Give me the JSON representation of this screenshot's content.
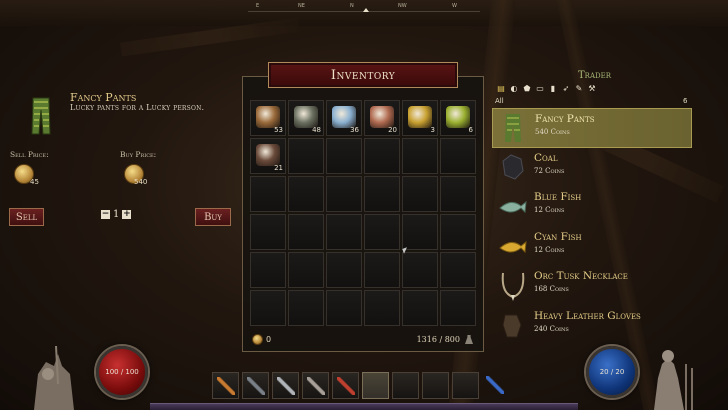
{
  "compass": {
    "ticks": [
      "E",
      "",
      "NE",
      "",
      "N",
      "",
      "NW",
      "",
      "W"
    ]
  },
  "selected_item": {
    "name": "Fancy Pants",
    "description": "Lucky pants for a Lucky person.",
    "sell_label": "Sell Price:",
    "sell_price": "45",
    "buy_label": "Buy Price:",
    "buy_price": "540",
    "sell_button": "Sell",
    "buy_button": "Buy",
    "quantity": "1",
    "minus": "−",
    "plus": "+"
  },
  "inventory": {
    "title": "Inventory",
    "items": [
      {
        "icon": "log-icon",
        "count": "53",
        "color": "#9a6a3a"
      },
      {
        "icon": "ore-icon",
        "count": "48",
        "color": "#6a7060"
      },
      {
        "icon": "fish-icon",
        "count": "36",
        "color": "#8ab0d0"
      },
      {
        "icon": "copper-ore-icon",
        "count": "20",
        "color": "#b06a50"
      },
      {
        "icon": "herb-icon",
        "count": "3",
        "color": "#c8a030"
      },
      {
        "icon": "flower-icon",
        "count": "6",
        "color": "#9ab030"
      },
      {
        "icon": "coal-icon",
        "count": "21",
        "color": "#6a4a3a"
      }
    ],
    "gold": "0",
    "weight": "1316 / 800"
  },
  "trader": {
    "title": "Trader",
    "filter_all": "All",
    "count": "6",
    "filters": [
      "▤",
      "◐",
      "⬟",
      "▭",
      "▮",
      "➶",
      "✎",
      "⚒"
    ],
    "items": [
      {
        "name": "Fancy Pants",
        "price": "540 Coins",
        "icon": "pants-icon",
        "selected": true
      },
      {
        "name": "Coal",
        "price": "72 Coins",
        "icon": "coal-icon",
        "selected": false
      },
      {
        "name": "Blue Fish",
        "price": "12 Coins",
        "icon": "blue-fish-icon",
        "selected": false
      },
      {
        "name": "Cyan Fish",
        "price": "12 Coins",
        "icon": "cyan-fish-icon",
        "selected": false
      },
      {
        "name": "Orc Tusk Necklace",
        "price": "168 Coins",
        "icon": "necklace-icon",
        "selected": false
      },
      {
        "name": "Heavy Leather Gloves",
        "price": "240 Coins",
        "icon": "gloves-icon",
        "selected": false
      }
    ]
  },
  "hud": {
    "health": "100 / 100",
    "mana": "20 / 20",
    "hotbar": [
      "torch-icon",
      "gauntlet-icon",
      "sword-icon",
      "axe-icon",
      "wand-icon",
      "",
      "",
      "",
      "",
      "bow-icon"
    ]
  }
}
